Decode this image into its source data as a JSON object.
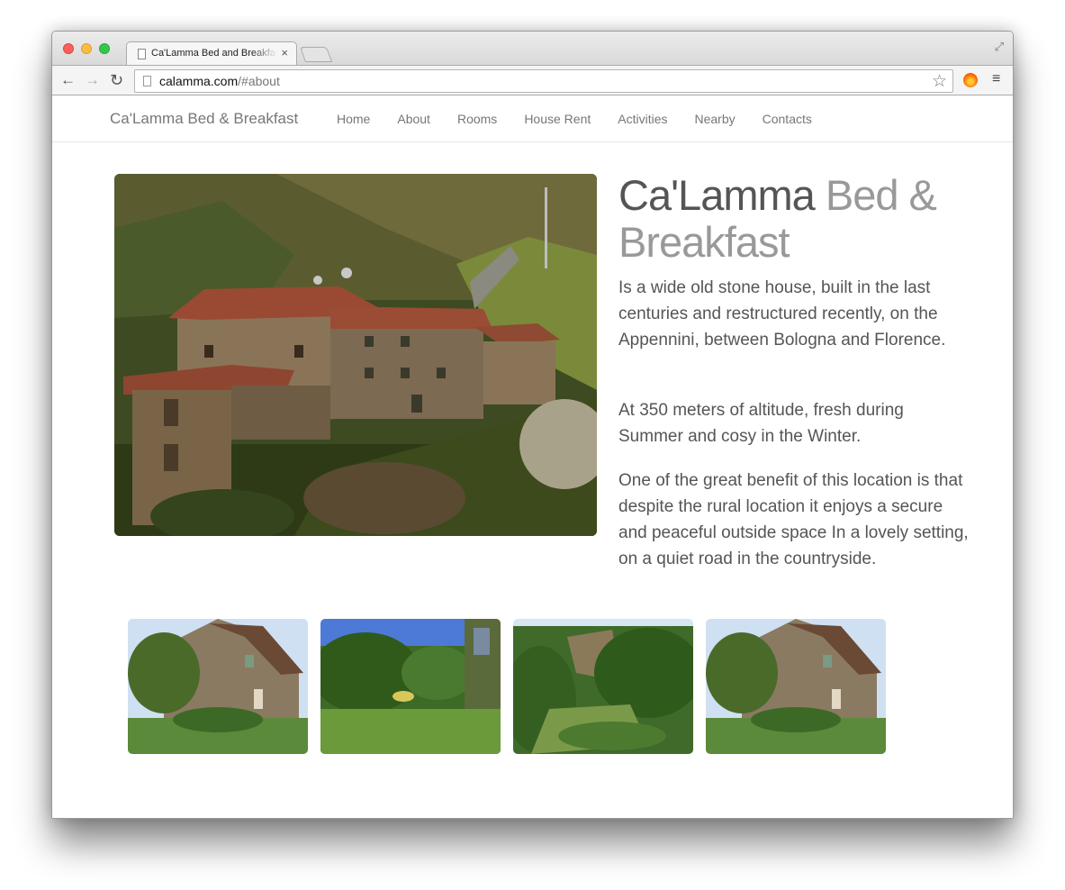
{
  "browser": {
    "tab_title": "Ca'Lamma Bed and Breakfast",
    "tab_close": "×",
    "url_host": "calamma.com",
    "url_rest": "/#about",
    "icons": {
      "back": "←",
      "forward": "→",
      "reload": "↻",
      "star": "☆",
      "menu": "≡",
      "fullscreen": "⤢"
    }
  },
  "nav": {
    "brand": "Ca'Lamma Bed & Breakfast",
    "links": [
      "Home",
      "About",
      "Rooms",
      "House Rent",
      "Activities",
      "Nearby",
      "Contacts"
    ]
  },
  "about": {
    "heading_main": "Ca'Lamma",
    "heading_muted": "Bed & Breakfast",
    "paragraphs": [
      "Is a wide old stone house, built in the last centuries and restructured recently, on the Appennini, between Bologna and Florence.",
      "At 350 meters of altitude, fresh during Summer and cosy in the Winter.",
      "One of the great benefit of this location is that despite the rural location it enjoys a secure and peaceful outside space In a lovely setting, on a quiet road in the countryside."
    ]
  },
  "colors": {
    "heading": "#555555",
    "heading_muted": "#999999",
    "nav_text": "#777777"
  }
}
